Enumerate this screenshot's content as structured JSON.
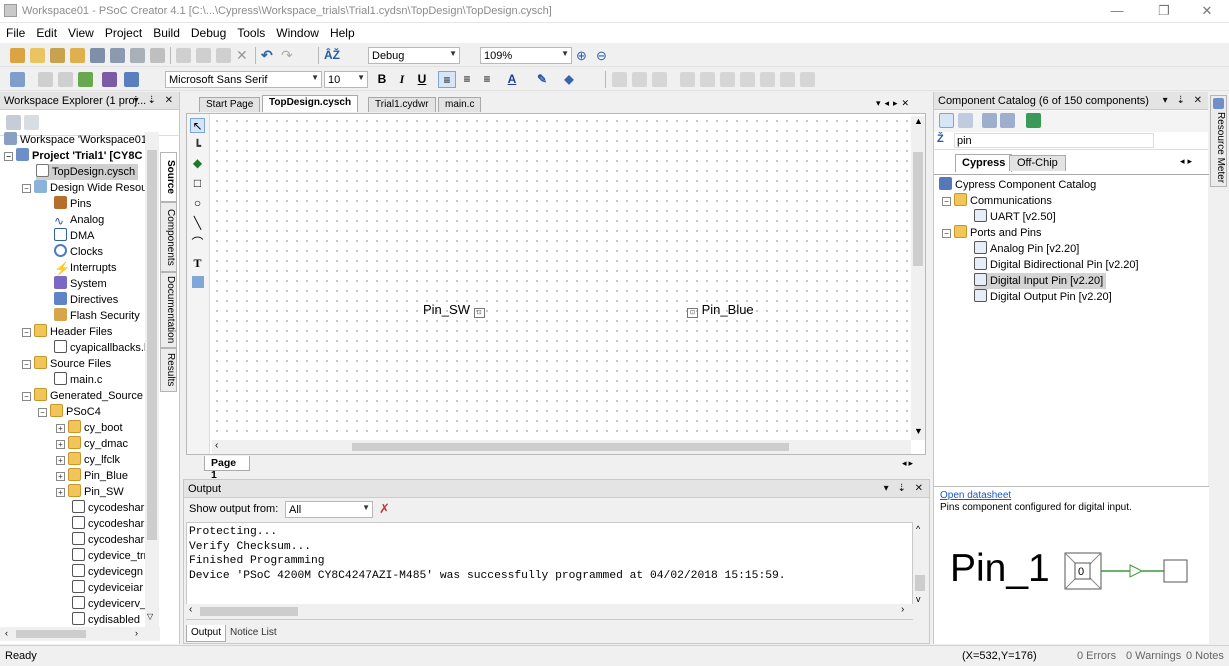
{
  "window": {
    "title": "Workspace01 - PSoC Creator 4.1  [C:\\...\\Cypress\\Workspace_trials\\Trial1.cydsn\\TopDesign\\TopDesign.cysch]",
    "min": "—",
    "max": "❐",
    "close": "✕"
  },
  "menu": [
    "File",
    "Edit",
    "View",
    "Project",
    "Build",
    "Debug",
    "Tools",
    "Window",
    "Help"
  ],
  "toolbar": {
    "config": "Debug",
    "zoom": "109%",
    "font": "Microsoft Sans Serif",
    "size": "10",
    "bold": "B",
    "italic": "I",
    "underline": "U"
  },
  "workspace": {
    "title": "Workspace Explorer (1 proj...",
    "items": [
      "Workspace 'Workspace01' (",
      "Project 'Trial1' [CY8C",
      "TopDesign.cysch",
      "Design Wide Resou",
      "Pins",
      "Analog",
      "DMA",
      "Clocks",
      "Interrupts",
      "System",
      "Directives",
      "Flash Security",
      "Header Files",
      "cyapicallbacks.l",
      "Source Files",
      "main.c",
      "Generated_Source",
      "PSoC4",
      "cy_boot",
      "cy_dmac",
      "cy_lfclk",
      "Pin_Blue",
      "Pin_SW",
      "cycodeshar",
      "cycodeshar",
      "cycodeshar",
      "cydevice_trr",
      "cydevicegn",
      "cydeviceiar",
      "cydevicerv_",
      "cydisabled"
    ],
    "side_tabs": [
      "Source",
      "Components",
      "Documentation",
      "Results"
    ]
  },
  "doc_tabs": [
    "Start Page",
    "TopDesign.cysch",
    "Trial1.cydwr",
    "main.c"
  ],
  "canvas": {
    "pins": [
      "Pin_SW",
      "Pin_Blue"
    ],
    "page_tab": "Page 1"
  },
  "output": {
    "title": "Output",
    "show_from_label": "Show output from:",
    "show_from_value": "All",
    "lines": [
      "Protecting...",
      "Verify Checksum...",
      "Finished Programming",
      "Device 'PSoC 4200M CY8C4247AZI-M485' was successfully programmed at 04/02/2018 15:15:59."
    ],
    "tabs": [
      "Output",
      "Notice List"
    ]
  },
  "catalog": {
    "title": "Component Catalog (6 of 150 components)",
    "search": "pin",
    "tabs": [
      "Cypress",
      "Off-Chip"
    ],
    "items": [
      "Cypress Component Catalog",
      "Communications",
      "UART [v2.50]",
      "Ports and Pins",
      "Analog Pin [v2.20]",
      "Digital Bidirectional Pin [v2.20]",
      "Digital Input Pin [v2.20]",
      "Digital Output Pin [v2.20]"
    ],
    "datasheet_link": "Open datasheet",
    "description": "Pins component configured for digital input.",
    "preview_name": "Pin_1",
    "preview_value": "0"
  },
  "resource_meter": "Resource Meter",
  "status": {
    "ready": "Ready",
    "coords": "(X=532,Y=176)",
    "errors": "0 Errors",
    "warnings": "0 Warnings",
    "notes": "0 Notes"
  }
}
